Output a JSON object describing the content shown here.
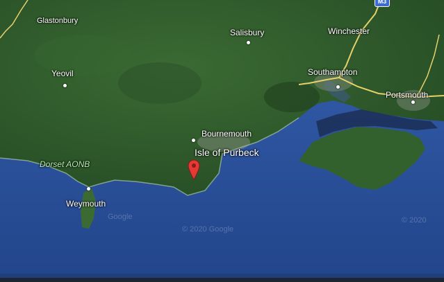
{
  "map": {
    "labels": {
      "glastonbury": "Glastonbury",
      "salisbury": "Salisbury",
      "winchester": "Winchester",
      "yeovil": "Yeovil",
      "southampton": "Southampton",
      "portsmouth": "Portsmouth",
      "bournemouth": "Bournemouth",
      "isle_of_purbeck": "Isle of Purbeck",
      "dorset_aonb": "Dorset AONB",
      "weymouth": "Weymouth"
    },
    "road_shield": "M3",
    "watermarks": [
      "Google",
      "© 2020 Google",
      "© 2020"
    ],
    "colors": {
      "land": "#2f5a2c",
      "sea": "#2a4d93",
      "road": "#e8d06a",
      "pin": "#e53935"
    },
    "marker": "location-pin-icon"
  }
}
